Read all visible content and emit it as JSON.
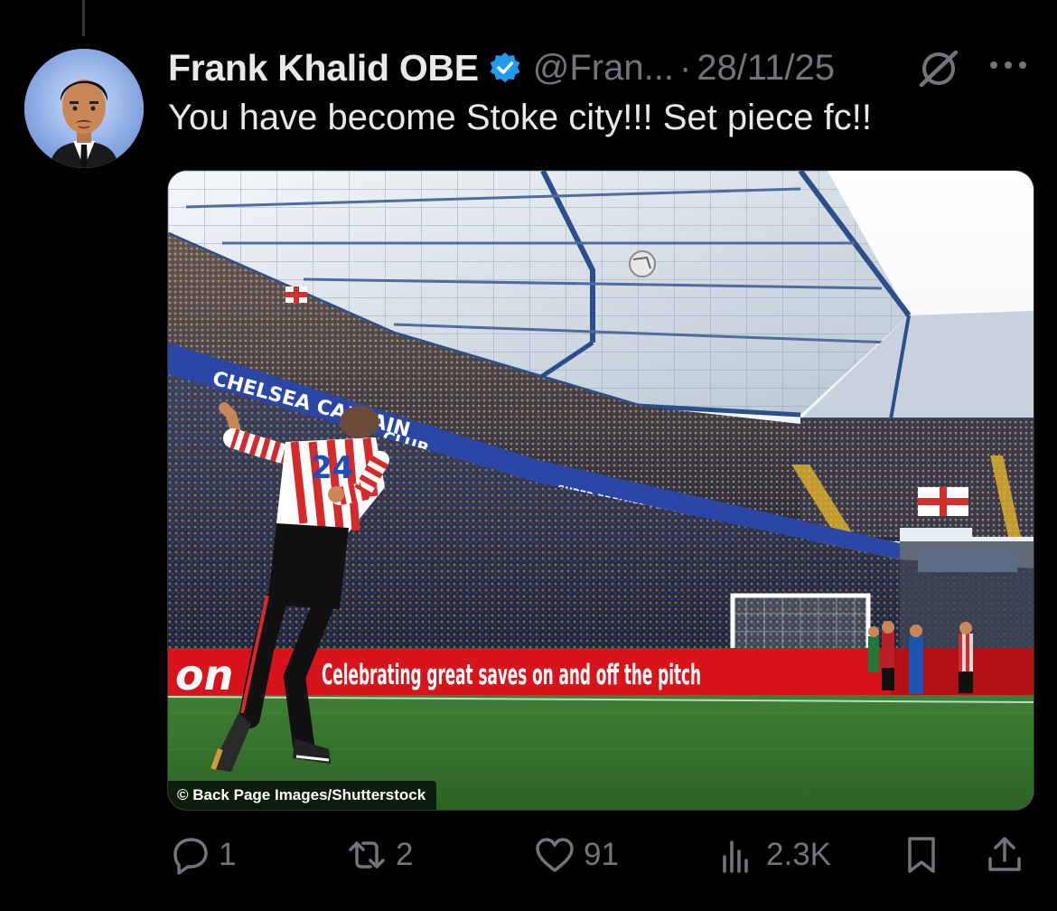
{
  "tweet": {
    "author_name": "Frank Khalid OBE",
    "handle": "@Fran...",
    "separator": "·",
    "date": "28/11/25",
    "text": "You have become Stoke city!!! Set piece fc!!",
    "verified": true
  },
  "media": {
    "credit": "© Back Page Images/Shutterstock",
    "ad_board_text": "Celebrating great saves on and off the pitch",
    "stand_text_left": "CHELSEA CAPTAIN",
    "stand_text_right": "CLUB",
    "stand_text_mid": "SUPER PREMIER LEAGUE",
    "player_number": "24"
  },
  "actions": {
    "reply_count": "1",
    "retweet_count": "2",
    "like_count": "91",
    "views_count": "2.3K"
  },
  "icons": [
    "reply-icon",
    "retweet-icon",
    "like-icon",
    "views-icon",
    "bookmark-icon",
    "share-icon",
    "grok-icon",
    "more-icon",
    "verified-icon"
  ],
  "colors": {
    "background": "#000000",
    "text_primary": "#e7e9ea",
    "text_secondary": "#71767b",
    "verified_blue": "#1d9bf0"
  }
}
